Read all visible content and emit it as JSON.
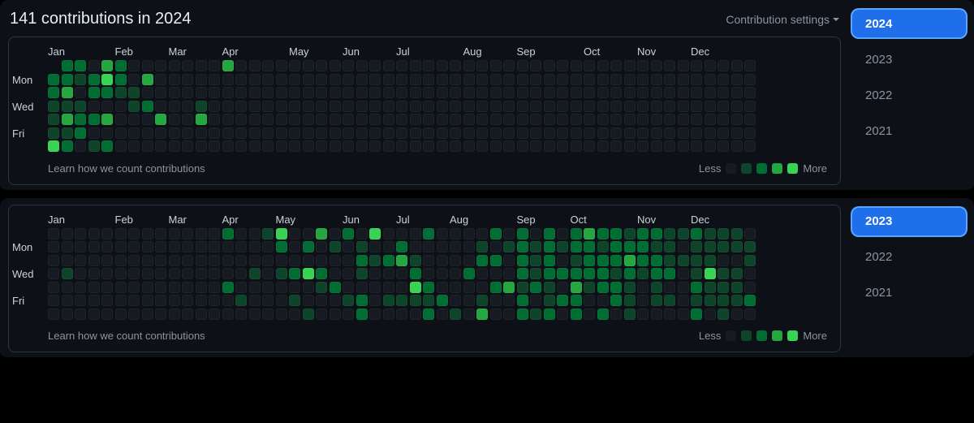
{
  "months": [
    "Jan",
    "Feb",
    "Mar",
    "Apr",
    "May",
    "Jun",
    "Jul",
    "Aug",
    "Sep",
    "Oct",
    "Nov",
    "Dec"
  ],
  "day_labels": [
    "Mon",
    "Wed",
    "Fri"
  ],
  "legend": {
    "less": "Less",
    "more": "More"
  },
  "learn_link": "Learn how we count contributions",
  "settings_label": "Contribution settings",
  "colors": {
    "empty": "#161b22",
    "l1": "#0e4429",
    "l2": "#006d32",
    "l3": "#26a641",
    "l4": "#39d353",
    "selected": "#1f6feb"
  },
  "sections": [
    {
      "title": "141 contributions in 2024",
      "show_header": true,
      "years": [
        "2024",
        "2023",
        "2022",
        "2021"
      ],
      "selected_year": "2024",
      "start_offset": 1,
      "month_starts": [
        0,
        5,
        9,
        13,
        18,
        22,
        26,
        31,
        35,
        40,
        44,
        48
      ],
      "weeks": [
        [
          0,
          2,
          2,
          1,
          1,
          1,
          4
        ],
        [
          2,
          2,
          3,
          1,
          3,
          1,
          2
        ],
        [
          2,
          1,
          0,
          1,
          2,
          2,
          0
        ],
        [
          0,
          2,
          2,
          0,
          2,
          0,
          1
        ],
        [
          3,
          4,
          2,
          0,
          3,
          0,
          2
        ],
        [
          2,
          2,
          1,
          0,
          0,
          0,
          0
        ],
        [
          0,
          0,
          1,
          1,
          0,
          0,
          0
        ],
        [
          0,
          3,
          0,
          2,
          0,
          0,
          0
        ],
        [
          0,
          0,
          0,
          0,
          3,
          0,
          0
        ],
        [
          0,
          0,
          0,
          0,
          0,
          0,
          0
        ],
        [
          0,
          0,
          0,
          0,
          0,
          0,
          0
        ],
        [
          0,
          0,
          0,
          1,
          3,
          0,
          0
        ],
        [
          0,
          0,
          0,
          0,
          0,
          0,
          0
        ],
        [
          3,
          0,
          0,
          0,
          0,
          0,
          0
        ],
        [
          0,
          0,
          0,
          0,
          0,
          0,
          0
        ],
        [
          0,
          0,
          0,
          0,
          0,
          0,
          0
        ],
        [
          0,
          0,
          0,
          0,
          0,
          0,
          0
        ],
        [
          0,
          0,
          0,
          0,
          0,
          0,
          0
        ],
        [
          0,
          0,
          0,
          0,
          0,
          0,
          0
        ],
        [
          0,
          0,
          0,
          0,
          0,
          0,
          0
        ],
        [
          0,
          0,
          0,
          0,
          0,
          0,
          0
        ],
        [
          0,
          0,
          0,
          0,
          0,
          0,
          0
        ],
        [
          0,
          0,
          0,
          0,
          0,
          0,
          0
        ],
        [
          0,
          0,
          0,
          0,
          0,
          0,
          0
        ],
        [
          0,
          0,
          0,
          0,
          0,
          0,
          0
        ],
        [
          0,
          0,
          0,
          0,
          0,
          0,
          0
        ],
        [
          0,
          0,
          0,
          0,
          0,
          0,
          0
        ],
        [
          0,
          0,
          0,
          0,
          0,
          0,
          0
        ],
        [
          0,
          0,
          0,
          0,
          0,
          0,
          0
        ],
        [
          0,
          0,
          0,
          0,
          0,
          0,
          0
        ],
        [
          0,
          0,
          0,
          0,
          0,
          0,
          0
        ],
        [
          0,
          0,
          0,
          0,
          0,
          0,
          0
        ],
        [
          0,
          0,
          0,
          0,
          0,
          0,
          0
        ],
        [
          0,
          0,
          0,
          0,
          0,
          0,
          0
        ],
        [
          0,
          0,
          0,
          0,
          0,
          0,
          0
        ],
        [
          0,
          0,
          0,
          0,
          0,
          0,
          0
        ],
        [
          0,
          0,
          0,
          0,
          0,
          0,
          0
        ],
        [
          0,
          0,
          0,
          0,
          0,
          0,
          0
        ],
        [
          0,
          0,
          0,
          0,
          0,
          0,
          0
        ],
        [
          0,
          0,
          0,
          0,
          0,
          0,
          0
        ],
        [
          0,
          0,
          0,
          0,
          0,
          0,
          0
        ],
        [
          0,
          0,
          0,
          0,
          0,
          0,
          0
        ],
        [
          0,
          0,
          0,
          0,
          0,
          0,
          0
        ],
        [
          0,
          0,
          0,
          0,
          0,
          0,
          0
        ],
        [
          0,
          0,
          0,
          0,
          0,
          0,
          0
        ],
        [
          0,
          0,
          0,
          0,
          0,
          0,
          0
        ],
        [
          0,
          0,
          0,
          0,
          0,
          0,
          0
        ],
        [
          0,
          0,
          0,
          0,
          0,
          0,
          0
        ],
        [
          0,
          0,
          0,
          0,
          0,
          0,
          0
        ],
        [
          0,
          0,
          0,
          0,
          0,
          0,
          0
        ],
        [
          0,
          0,
          0,
          0,
          0,
          0,
          0
        ],
        [
          0,
          0,
          0,
          0,
          0,
          0,
          0
        ],
        [
          0,
          0,
          0,
          0,
          0,
          0,
          0
        ]
      ]
    },
    {
      "title": "",
      "show_header": false,
      "years": [
        "2023",
        "2022",
        "2021"
      ],
      "selected_year": "2023",
      "start_offset": 0,
      "month_starts": [
        0,
        5,
        9,
        13,
        17,
        22,
        26,
        30,
        35,
        39,
        44,
        48
      ],
      "weeks": [
        [
          0,
          0,
          0,
          0,
          0,
          0,
          0
        ],
        [
          0,
          0,
          0,
          1,
          0,
          0,
          0
        ],
        [
          0,
          0,
          0,
          0,
          0,
          0,
          0
        ],
        [
          0,
          0,
          0,
          0,
          0,
          0,
          0
        ],
        [
          0,
          0,
          0,
          0,
          0,
          0,
          0
        ],
        [
          0,
          0,
          0,
          0,
          0,
          0,
          0
        ],
        [
          0,
          0,
          0,
          0,
          0,
          0,
          0
        ],
        [
          0,
          0,
          0,
          0,
          0,
          0,
          0
        ],
        [
          0,
          0,
          0,
          0,
          0,
          0,
          0
        ],
        [
          0,
          0,
          0,
          0,
          0,
          0,
          0
        ],
        [
          0,
          0,
          0,
          0,
          0,
          0,
          0
        ],
        [
          0,
          0,
          0,
          0,
          0,
          0,
          0
        ],
        [
          0,
          0,
          0,
          0,
          0,
          0,
          0
        ],
        [
          2,
          0,
          0,
          0,
          2,
          0,
          0
        ],
        [
          0,
          0,
          0,
          0,
          0,
          1,
          0
        ],
        [
          0,
          0,
          0,
          1,
          0,
          0,
          0
        ],
        [
          1,
          0,
          0,
          0,
          0,
          0,
          0
        ],
        [
          4,
          2,
          0,
          1,
          0,
          0,
          0
        ],
        [
          0,
          0,
          0,
          2,
          0,
          1,
          0
        ],
        [
          0,
          2,
          0,
          4,
          0,
          0,
          1
        ],
        [
          3,
          0,
          0,
          2,
          1,
          0,
          0
        ],
        [
          0,
          1,
          0,
          0,
          2,
          0,
          0
        ],
        [
          2,
          0,
          0,
          0,
          0,
          1,
          0
        ],
        [
          0,
          1,
          2,
          1,
          0,
          2,
          2
        ],
        [
          4,
          0,
          1,
          0,
          0,
          0,
          0
        ],
        [
          0,
          0,
          2,
          0,
          0,
          1,
          0
        ],
        [
          0,
          2,
          3,
          0,
          0,
          1,
          0
        ],
        [
          0,
          0,
          1,
          2,
          4,
          1,
          0
        ],
        [
          2,
          0,
          0,
          0,
          2,
          1,
          2
        ],
        [
          0,
          0,
          0,
          0,
          0,
          2,
          0
        ],
        [
          0,
          0,
          0,
          0,
          0,
          0,
          1
        ],
        [
          0,
          0,
          0,
          2,
          0,
          0,
          0
        ],
        [
          0,
          1,
          2,
          0,
          0,
          1,
          3
        ],
        [
          2,
          0,
          2,
          0,
          2,
          0,
          0
        ],
        [
          0,
          1,
          0,
          0,
          3,
          0,
          0
        ],
        [
          2,
          2,
          2,
          2,
          1,
          2,
          2
        ],
        [
          0,
          1,
          1,
          1,
          2,
          0,
          1
        ],
        [
          2,
          2,
          2,
          2,
          1,
          1,
          2
        ],
        [
          0,
          1,
          0,
          2,
          0,
          2,
          0
        ],
        [
          2,
          2,
          1,
          2,
          3,
          2,
          2
        ],
        [
          3,
          2,
          2,
          2,
          1,
          0,
          0
        ],
        [
          2,
          1,
          2,
          2,
          2,
          0,
          2
        ],
        [
          2,
          2,
          2,
          1,
          2,
          2,
          0
        ],
        [
          1,
          2,
          3,
          2,
          1,
          1,
          1
        ],
        [
          2,
          2,
          2,
          1,
          0,
          0,
          0
        ],
        [
          2,
          1,
          2,
          2,
          1,
          1,
          0
        ],
        [
          1,
          1,
          1,
          2,
          0,
          1,
          0
        ],
        [
          1,
          0,
          1,
          0,
          0,
          0,
          0
        ],
        [
          2,
          1,
          1,
          1,
          2,
          1,
          2
        ],
        [
          1,
          1,
          1,
          4,
          1,
          1,
          0
        ],
        [
          1,
          1,
          0,
          1,
          1,
          1,
          1
        ],
        [
          1,
          1,
          0,
          1,
          1,
          1,
          0
        ],
        [
          0,
          1,
          1,
          0,
          0,
          2,
          0
        ]
      ]
    }
  ]
}
